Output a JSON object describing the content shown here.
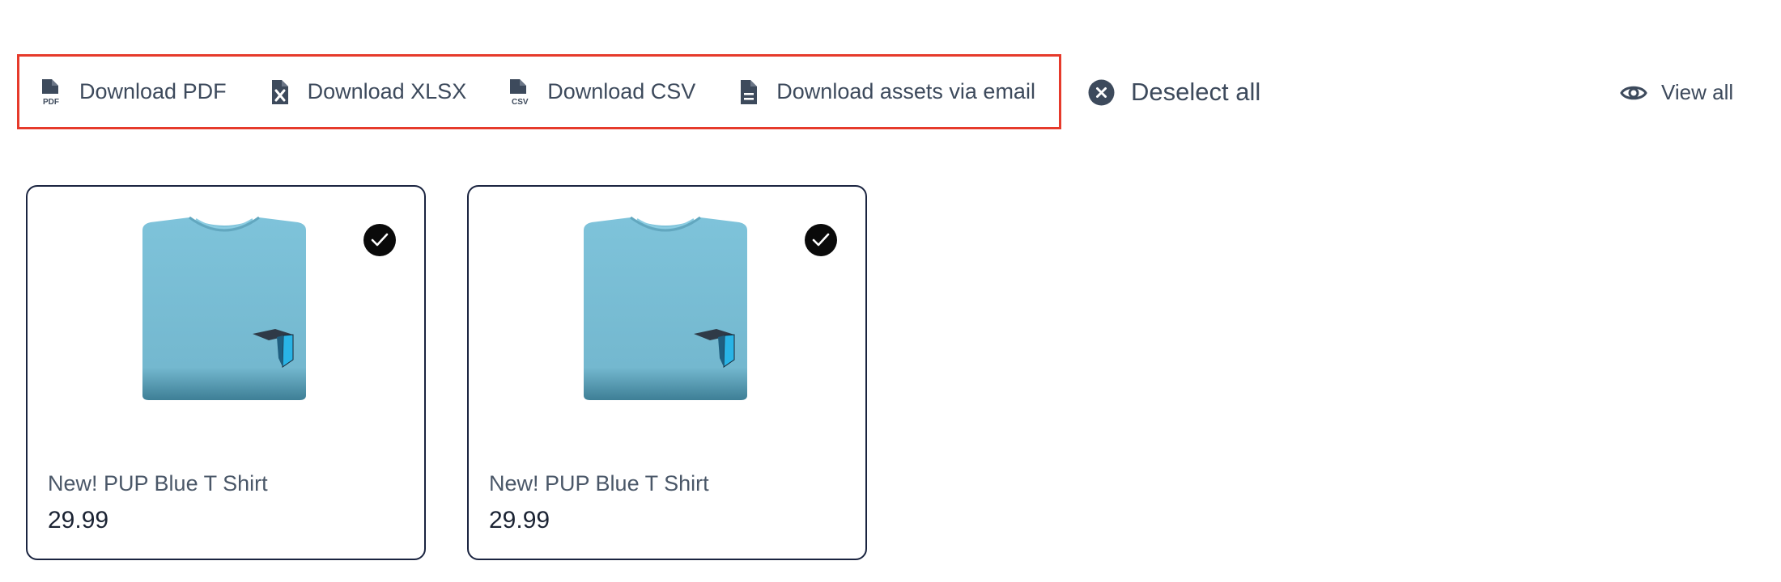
{
  "toolbar": {
    "download_pdf": {
      "label": "Download PDF",
      "icon": "file-pdf-icon"
    },
    "download_xlsx": {
      "label": "Download XLSX",
      "icon": "file-excel-icon"
    },
    "download_csv": {
      "label": "Download CSV",
      "icon": "file-csv-icon"
    },
    "download_email": {
      "label": "Download assets via email",
      "icon": "file-document-icon"
    },
    "highlight_color": "#e63a2b"
  },
  "deselect_all": {
    "label": "Deselect all",
    "icon": "close-circle-icon"
  },
  "view_all": {
    "label": "View all",
    "icon": "eye-icon"
  },
  "products": [
    {
      "name": "New! PUP Blue T Shirt",
      "price": "29.99",
      "selected": true,
      "image": "blue-t-shirt"
    },
    {
      "name": "New! PUP Blue T Shirt",
      "price": "29.99",
      "selected": true,
      "image": "blue-t-shirt"
    }
  ],
  "colors": {
    "text": "#3d4a5c",
    "card_border": "#1a2440",
    "shirt": "#79bfd6",
    "check_bg": "#0a0a0a"
  }
}
